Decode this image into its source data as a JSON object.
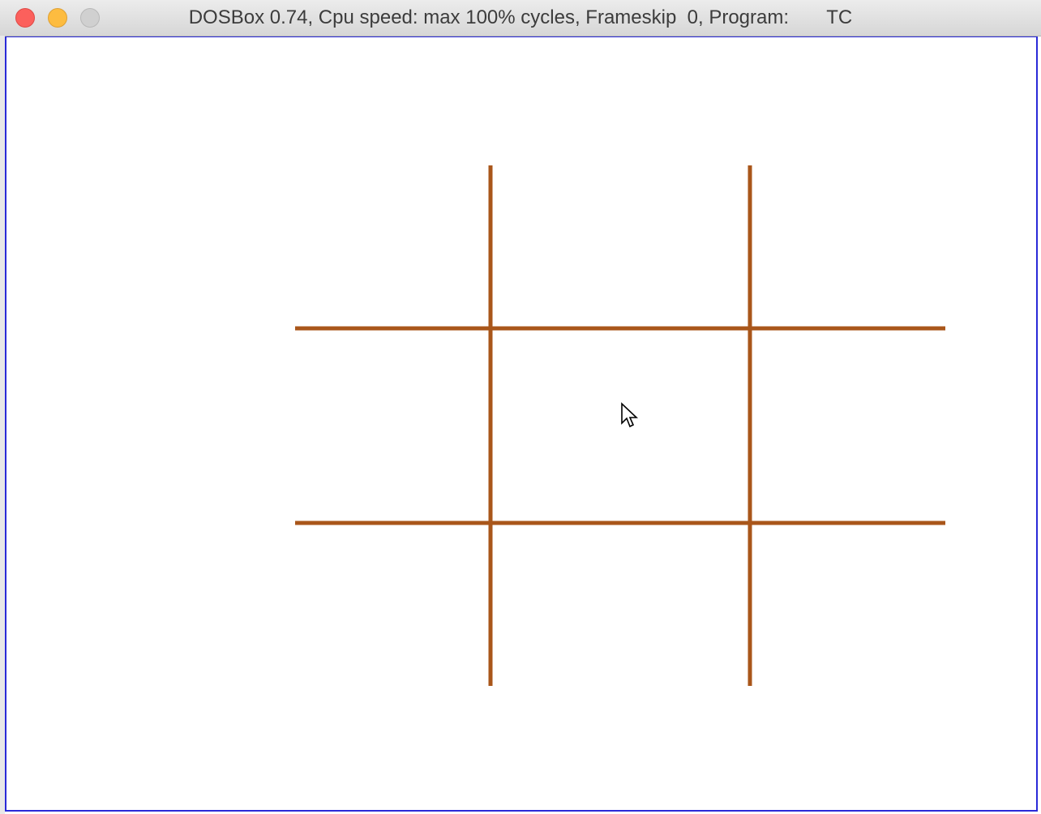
{
  "window": {
    "title": "DOSBox 0.74, Cpu speed: max 100% cycles, Frameskip  0, Program:       TC"
  },
  "colors": {
    "grid_line": "#a9561a",
    "canvas_bg": "#ffffff",
    "border": "#2a2ad8"
  },
  "icons": {
    "close": "close-icon",
    "minimize": "minimize-icon",
    "zoom": "zoom-icon",
    "cursor": "mouse-pointer-icon"
  }
}
